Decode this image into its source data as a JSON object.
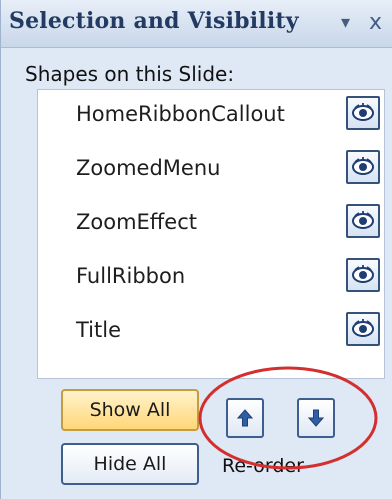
{
  "pane": {
    "title": "Selection and Visibility",
    "dropdown_glyph": "▾",
    "close_glyph": "x"
  },
  "shapes": {
    "heading": "Shapes on this Slide:",
    "items": [
      {
        "label": "HomeRibbonCallout",
        "visibility_icon": "eye-icon"
      },
      {
        "label": "ZoomedMenu",
        "visibility_icon": "eye-icon"
      },
      {
        "label": "ZoomEffect",
        "visibility_icon": "eye-icon"
      },
      {
        "label": "FullRibbon",
        "visibility_icon": "eye-icon"
      },
      {
        "label": "Title",
        "visibility_icon": "eye-icon"
      }
    ]
  },
  "buttons": {
    "show_all": "Show All",
    "hide_all": "Hide All",
    "move_up_icon": "arrow-up-icon",
    "move_down_icon": "arrow-down-icon"
  },
  "reorder": {
    "label": "Re-order"
  },
  "colors": {
    "highlight_ellipse": "#d32f2f",
    "show_all_fill": "#ffd778",
    "accent_blue": "#3d5e8f"
  }
}
